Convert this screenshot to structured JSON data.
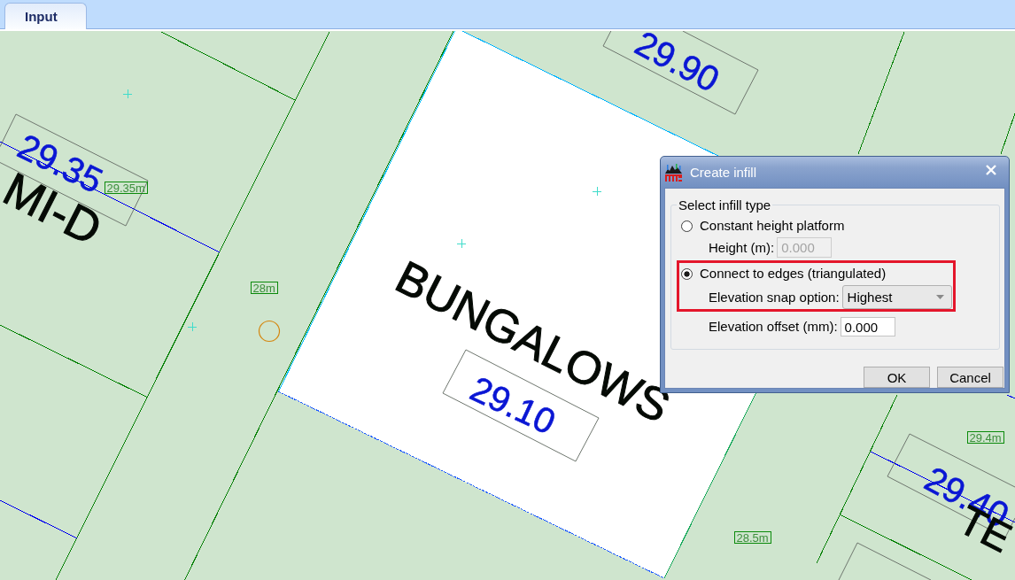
{
  "tabs": [
    {
      "label": "Input",
      "selected": true
    }
  ],
  "map": {
    "labels": [
      {
        "kind": "elevation",
        "text": "29.90"
      },
      {
        "kind": "elevation",
        "text": "29.35"
      },
      {
        "kind": "spot_height",
        "text": "29.35m"
      },
      {
        "kind": "area_name",
        "text": "MI-D"
      },
      {
        "kind": "spot_height",
        "text": "28m"
      },
      {
        "kind": "area_name",
        "text": "BUNGALOWS"
      },
      {
        "kind": "elevation",
        "text": "29.10"
      },
      {
        "kind": "spot_height",
        "text": "29.4m"
      },
      {
        "kind": "elevation",
        "text": "29.40"
      },
      {
        "kind": "area_name",
        "text": "TE"
      },
      {
        "kind": "spot_height",
        "text": "28.5m"
      }
    ]
  },
  "dialog": {
    "title": "Create infill",
    "group_title": "Select infill type",
    "options": [
      {
        "label": "Constant height platform",
        "selected": false,
        "highlighted": false,
        "fields": [
          {
            "kind": "text",
            "label": "Height (m):",
            "value": "0.000",
            "disabled": true
          }
        ]
      },
      {
        "label": "Connect to edges (triangulated)",
        "selected": true,
        "highlighted": true,
        "fields": [
          {
            "kind": "dropdown",
            "label": "Elevation snap option:",
            "value": "Highest",
            "disabled": false
          }
        ]
      }
    ],
    "fields": [
      {
        "kind": "text",
        "label": "Elevation offset (mm):",
        "value": "0.000",
        "disabled": false
      }
    ],
    "buttons": [
      "OK",
      "Cancel"
    ]
  }
}
